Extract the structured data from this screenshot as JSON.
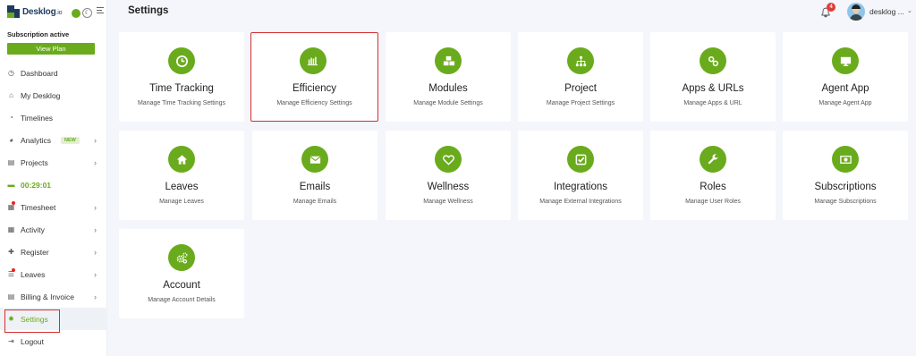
{
  "app": {
    "brand": "Desklog",
    "brand_suffix": ".io"
  },
  "subscription": {
    "status": "Subscription active",
    "button": "View Plan"
  },
  "sidebar": {
    "items": [
      {
        "label": "Dashboard",
        "icon": "dashboard-icon"
      },
      {
        "label": "My Desklog",
        "icon": "home-icon"
      },
      {
        "label": "Timelines",
        "icon": "clock-icon"
      },
      {
        "label": "Analytics",
        "icon": "pie-chart-icon",
        "badge": "NEW"
      },
      {
        "label": "Projects",
        "icon": "book-icon"
      },
      {
        "label": "00:29:01",
        "icon": "timer-icon"
      },
      {
        "label": "Timesheet",
        "icon": "calendar-icon"
      },
      {
        "label": "Activity",
        "icon": "grid-icon"
      },
      {
        "label": "Register",
        "icon": "plus-icon"
      },
      {
        "label": "Leaves",
        "icon": "list-icon"
      },
      {
        "label": "Billing & Invoice",
        "icon": "invoice-icon"
      },
      {
        "label": "Settings",
        "icon": "gear-icon"
      },
      {
        "label": "Logout",
        "icon": "logout-icon"
      }
    ]
  },
  "header": {
    "title": "Settings",
    "notification_count": "4",
    "user_name": "desklog ...",
    "user_chevron": "⌄"
  },
  "cards": [
    {
      "title": "Time Tracking",
      "subtitle": "Manage Time Tracking Settings",
      "icon": "clock-icon"
    },
    {
      "title": "Efficiency",
      "subtitle": "Manage Efficiency Settings",
      "icon": "bar-chart-icon"
    },
    {
      "title": "Modules",
      "subtitle": "Manage Module Settings",
      "icon": "cubes-icon"
    },
    {
      "title": "Project",
      "subtitle": "Manage Project Settings",
      "icon": "sitemap-icon"
    },
    {
      "title": "Apps & URLs",
      "subtitle": "Manage Apps & URL",
      "icon": "link-icon"
    },
    {
      "title": "Agent App",
      "subtitle": "Manage Agent App",
      "icon": "monitor-icon"
    },
    {
      "title": "Leaves",
      "subtitle": "Manage Leaves",
      "icon": "home-icon"
    },
    {
      "title": "Emails",
      "subtitle": "Manage Emails",
      "icon": "envelope-icon"
    },
    {
      "title": "Wellness",
      "subtitle": "Manage Wellness",
      "icon": "heart-icon"
    },
    {
      "title": "Integrations",
      "subtitle": "Manage External Integrations",
      "icon": "check-square-icon"
    },
    {
      "title": "Roles",
      "subtitle": "Manage User Roles",
      "icon": "wrench-icon"
    },
    {
      "title": "Subscriptions",
      "subtitle": "Manage Subscriptions",
      "icon": "money-icon"
    },
    {
      "title": "Account",
      "subtitle": "Manage Account Details",
      "icon": "cogs-icon"
    }
  ],
  "colors": {
    "accent": "#6aab1d",
    "highlight": "#d32f2f",
    "badge": "#e53935"
  }
}
